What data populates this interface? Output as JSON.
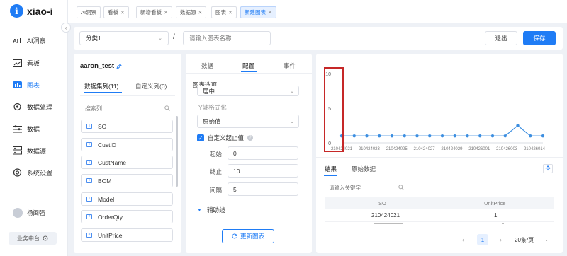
{
  "app": {
    "logo_letter": "i",
    "logo_text": "xiao-i"
  },
  "sidebar": {
    "items": [
      {
        "label": "AI洞察",
        "icon": "ai-insight-icon"
      },
      {
        "label": "看板",
        "icon": "dashboard-icon"
      },
      {
        "label": "图表",
        "icon": "chart-icon"
      },
      {
        "label": "数据处理",
        "icon": "data-processing-icon"
      },
      {
        "label": "数据",
        "icon": "data-icon"
      },
      {
        "label": "数据源",
        "icon": "datasource-icon"
      },
      {
        "label": "系统设置",
        "icon": "settings-icon"
      }
    ],
    "active_index": 2,
    "user_name": "杨闽强",
    "workspace": "业务中台",
    "collapse_glyph": "‹"
  },
  "tabs": [
    {
      "label": "AI洞察",
      "closable": false
    },
    {
      "label": "看板",
      "closable": true
    },
    {
      "label": "新增看板",
      "closable": true
    },
    {
      "label": "数据源",
      "closable": true
    },
    {
      "label": "图表",
      "closable": true
    },
    {
      "label": "新建图表",
      "closable": true
    }
  ],
  "toolbar": {
    "category_value": "分类1",
    "separator": "/",
    "name_placeholder": "请输入图表名称",
    "exit_label": "退出",
    "save_label": "保存"
  },
  "dataset": {
    "name": "aaron_test",
    "tab_dataset": "数据集列(11)",
    "tab_custom": "自定义列(0)",
    "search_placeholder": "搜索列",
    "fields": [
      "SO",
      "CustID",
      "CustName",
      "BOM",
      "Model",
      "OrderQty",
      "UnitPrice"
    ]
  },
  "config": {
    "tab_data": "数据",
    "tab_config": "配置",
    "tab_event": "事件",
    "section_chart_options": "图表选项",
    "align_value": "居中",
    "y_axis_format_label": "Y轴格式化",
    "y_axis_format_value": "原始值",
    "custom_range_label": "自定义起止值",
    "start_label": "起始",
    "start_value": "0",
    "end_label": "终止",
    "end_value": "10",
    "interval_label": "间隔",
    "interval_value": "5",
    "aux_line_label": "辅助线",
    "update_button": "更新图表"
  },
  "chart_data": {
    "type": "line",
    "x": [
      "210424021",
      "210424023",
      "210424025",
      "210424027",
      "210424029",
      "210426001",
      "210426003",
      "210426014"
    ],
    "y": [
      1,
      1,
      1,
      1,
      1,
      1,
      1,
      1,
      1,
      1,
      1,
      1,
      1,
      1,
      2.5,
      1,
      1
    ],
    "yticks": [
      0,
      5,
      10
    ],
    "ylim": [
      0,
      10
    ],
    "color": "#3c8ee0",
    "highlight_color": "#c62828"
  },
  "results": {
    "tab_result": "结果",
    "tab_raw": "原始数据",
    "search_placeholder": "请输入关键字",
    "columns": [
      "SO",
      "UnitPrice"
    ],
    "rows": [
      [
        "210424021",
        "1"
      ]
    ],
    "page": "1",
    "page_size": "20条/页"
  }
}
